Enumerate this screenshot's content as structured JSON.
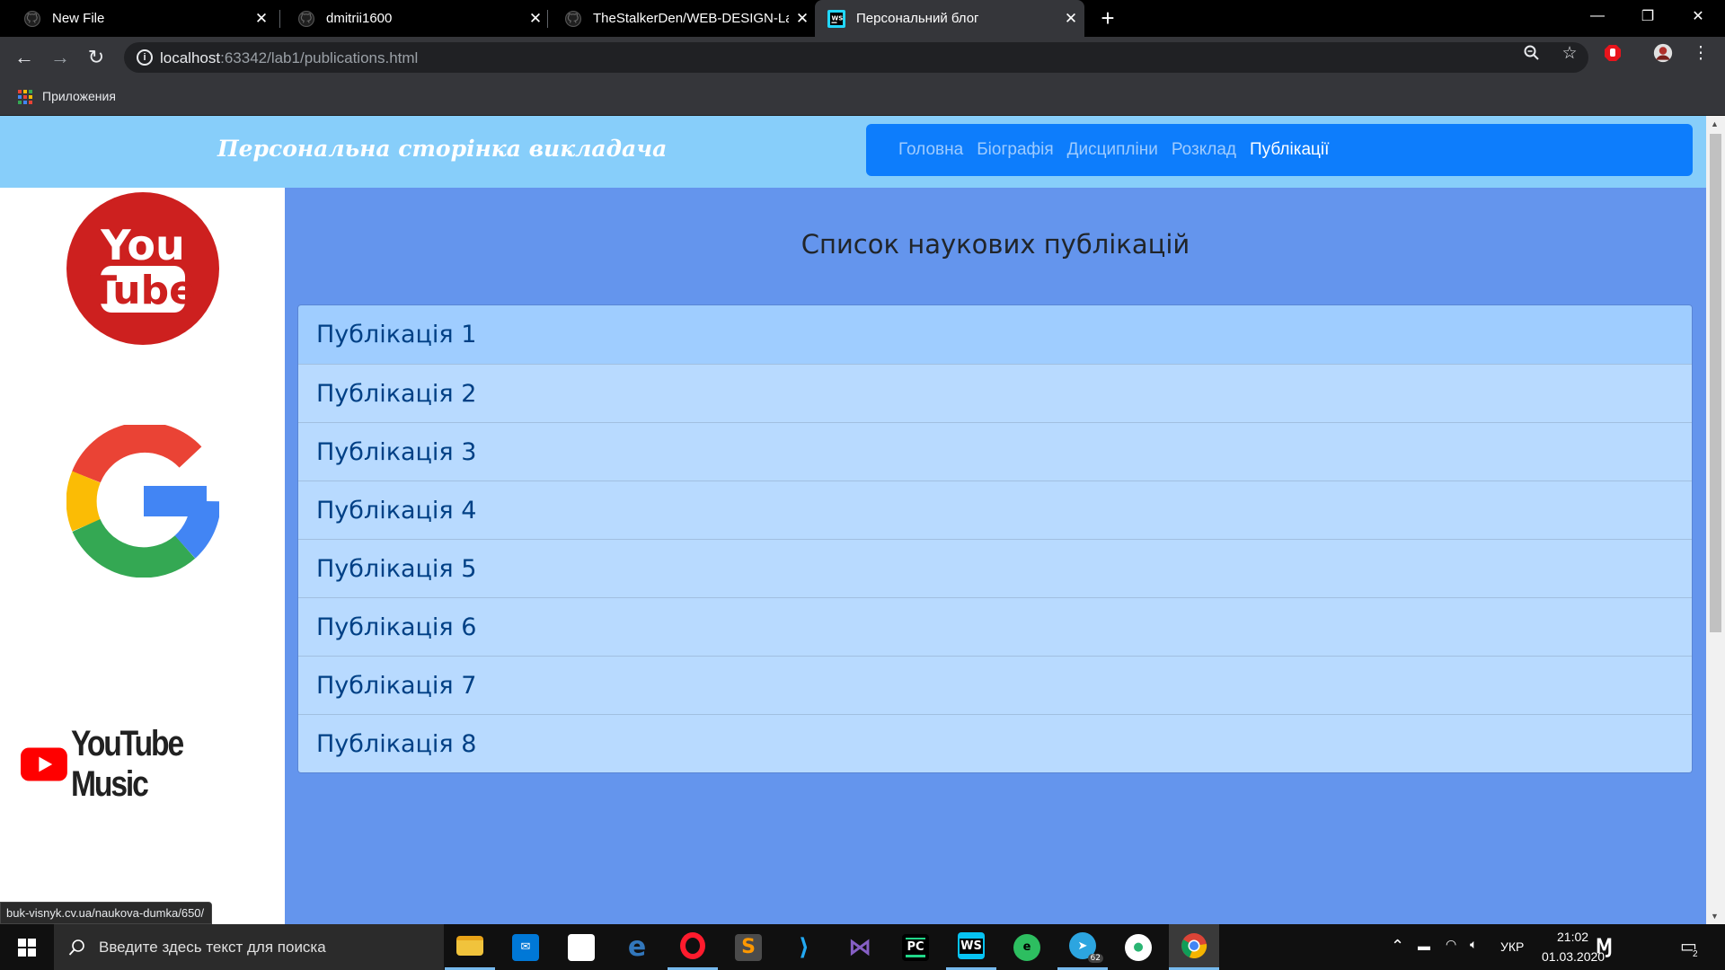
{
  "browser": {
    "tabs": [
      {
        "title": "New File",
        "icon": "github-icon",
        "active": false
      },
      {
        "title": "dmitrii1600",
        "icon": "github-icon",
        "active": false
      },
      {
        "title": "TheStalkerDen/WEB-DESIGN-Lab",
        "icon": "github-icon",
        "active": false
      },
      {
        "title": "Персональний блог",
        "icon": "webstorm-icon",
        "active": true
      }
    ],
    "url_host": "localhost",
    "url_rest": ":63342/lab1/publications.html",
    "bookmarks": {
      "apps_label": "Приложения"
    },
    "status_url": "buk-visnyk.cv.ua/naukova-dumka/650/"
  },
  "site": {
    "title": "Персональна сторінка викладача",
    "nav": [
      "Головна",
      "Біографія",
      "Дисципліни",
      "Розклад",
      "Публікації"
    ],
    "active_nav": "Публікації",
    "sidebar": [
      {
        "name": "youtube-logo",
        "text_1": "You",
        "text_2": "Tube"
      },
      {
        "name": "google-logo"
      },
      {
        "name": "youtube-music-logo",
        "text": "YouTube Music"
      }
    ],
    "heading": "Список наукових публікацій",
    "publications": [
      "Публікація 1",
      "Публікація 2",
      "Публікація 3",
      "Публікація 4",
      "Публікація 5",
      "Публікація 6",
      "Публікація 7",
      "Публікація 8"
    ]
  },
  "taskbar": {
    "search_placeholder": "Введите здесь текст для поиска",
    "apps": [
      "file-explorer-icon",
      "mail-icon",
      "store-icon",
      "edge-icon",
      "opera-icon",
      "sublime-text-icon",
      "vscode-icon",
      "visual-studio-icon",
      "pycharm-icon",
      "webstorm-icon",
      "evernote-icon",
      "telegram-icon",
      "drop-icon",
      "chrome-icon"
    ],
    "telegram_badge": "62",
    "language": "УКР",
    "time": "21:02",
    "date": "01.03.2020",
    "notifications": "2"
  },
  "colors": {
    "header_bg": "#87cefa",
    "nav_bg": "#0d7dfc",
    "main_bg": "#6495ed",
    "list_item_bg": "#b8daff",
    "list_item_text": "#004085"
  }
}
